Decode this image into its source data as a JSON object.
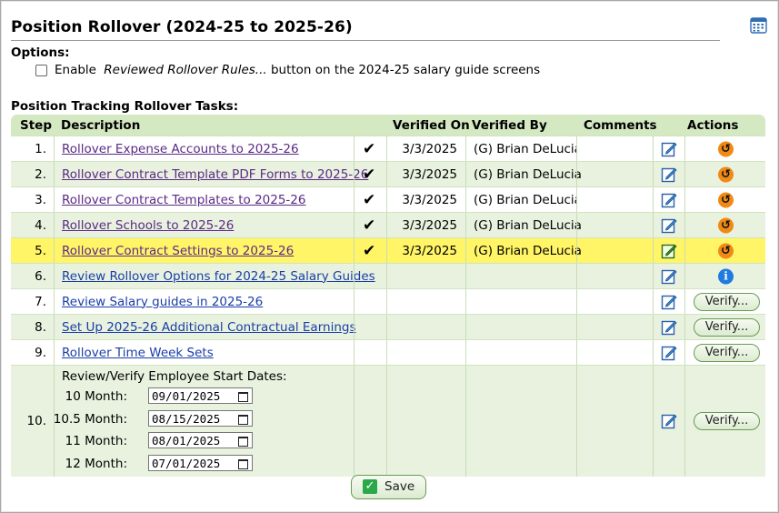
{
  "title": "Position Rollover (2024-25 to 2025-26)",
  "icons": {
    "calendar": "calendar-icon",
    "edit": "edit-note-icon",
    "undo": "undo-icon",
    "info": "info-icon",
    "check": "checkmark-icon"
  },
  "options": {
    "label": "Options:",
    "checkbox_checked": false,
    "text_before": "Enable ",
    "text_italic": "Reviewed Rollover Rules...",
    "text_after": " button on the 2024-25 salary guide screens"
  },
  "section_label": "Position Tracking Rollover Tasks:",
  "columns": {
    "step": "Step",
    "description": "Description",
    "verified_on": "Verified On",
    "verified_by": "Verified By",
    "comments": "Comments",
    "actions": "Actions"
  },
  "rows": [
    {
      "step": "1.",
      "description": "Rollover Expense Accounts to 2025-26",
      "checked": true,
      "verified_on": "3/3/2025",
      "verified_by": "(G) Brian DeLucia",
      "comments": "",
      "action": "undo"
    },
    {
      "step": "2.",
      "description": "Rollover Contract Template PDF Forms to 2025-26",
      "checked": true,
      "verified_on": "3/3/2025",
      "verified_by": "(G) Brian DeLucia",
      "comments": "",
      "action": "undo"
    },
    {
      "step": "3.",
      "description": "Rollover Contract Templates to 2025-26",
      "checked": true,
      "verified_on": "3/3/2025",
      "verified_by": "(G) Brian DeLucia",
      "comments": "",
      "action": "undo"
    },
    {
      "step": "4.",
      "description": "Rollover Schools to 2025-26",
      "checked": true,
      "verified_on": "3/3/2025",
      "verified_by": "(G) Brian DeLucia",
      "comments": "",
      "action": "undo"
    },
    {
      "step": "5.",
      "description": "Rollover Contract Settings to 2025-26",
      "checked": true,
      "verified_on": "3/3/2025",
      "verified_by": "(G) Brian DeLucia",
      "comments": "",
      "action": "undo",
      "highlighted": true
    },
    {
      "step": "6.",
      "description": "Review Rollover Options for 2024-25 Salary Guides",
      "checked": false,
      "verified_on": "",
      "verified_by": "",
      "comments": "",
      "action": "info"
    },
    {
      "step": "7.",
      "description": "Review Salary guides in 2025-26",
      "checked": false,
      "verified_on": "",
      "verified_by": "",
      "comments": "",
      "action": "verify"
    },
    {
      "step": "8.",
      "description": "Set Up 2025-26 Additional Contractual Earnings",
      "checked": false,
      "verified_on": "",
      "verified_by": "",
      "comments": "",
      "action": "verify"
    },
    {
      "step": "9.",
      "description": "Rollover Time Week Sets",
      "checked": false,
      "verified_on": "",
      "verified_by": "",
      "comments": "",
      "action": "verify"
    }
  ],
  "step10": {
    "step": "10.",
    "title": "Review/Verify Employee Start Dates:",
    "dates": [
      {
        "label": "10 Month:",
        "value": "09/01/2025"
      },
      {
        "label": "10.5 Month:",
        "value": "08/15/2025"
      },
      {
        "label": "11 Month:",
        "value": "08/01/2025"
      },
      {
        "label": "12 Month:",
        "value": "07/01/2025"
      }
    ],
    "action": "verify"
  },
  "verify_label": "Verify...",
  "save_label": "Save",
  "colors": {
    "header_bg": "#d4e8c2",
    "row_alt": "#e8f2df",
    "highlight": "#fff566",
    "link_visited": "#5b2a86",
    "link": "#1a3ea8",
    "undo": "#f08a16",
    "info": "#1e7be0",
    "save_check": "#2aa84a"
  }
}
